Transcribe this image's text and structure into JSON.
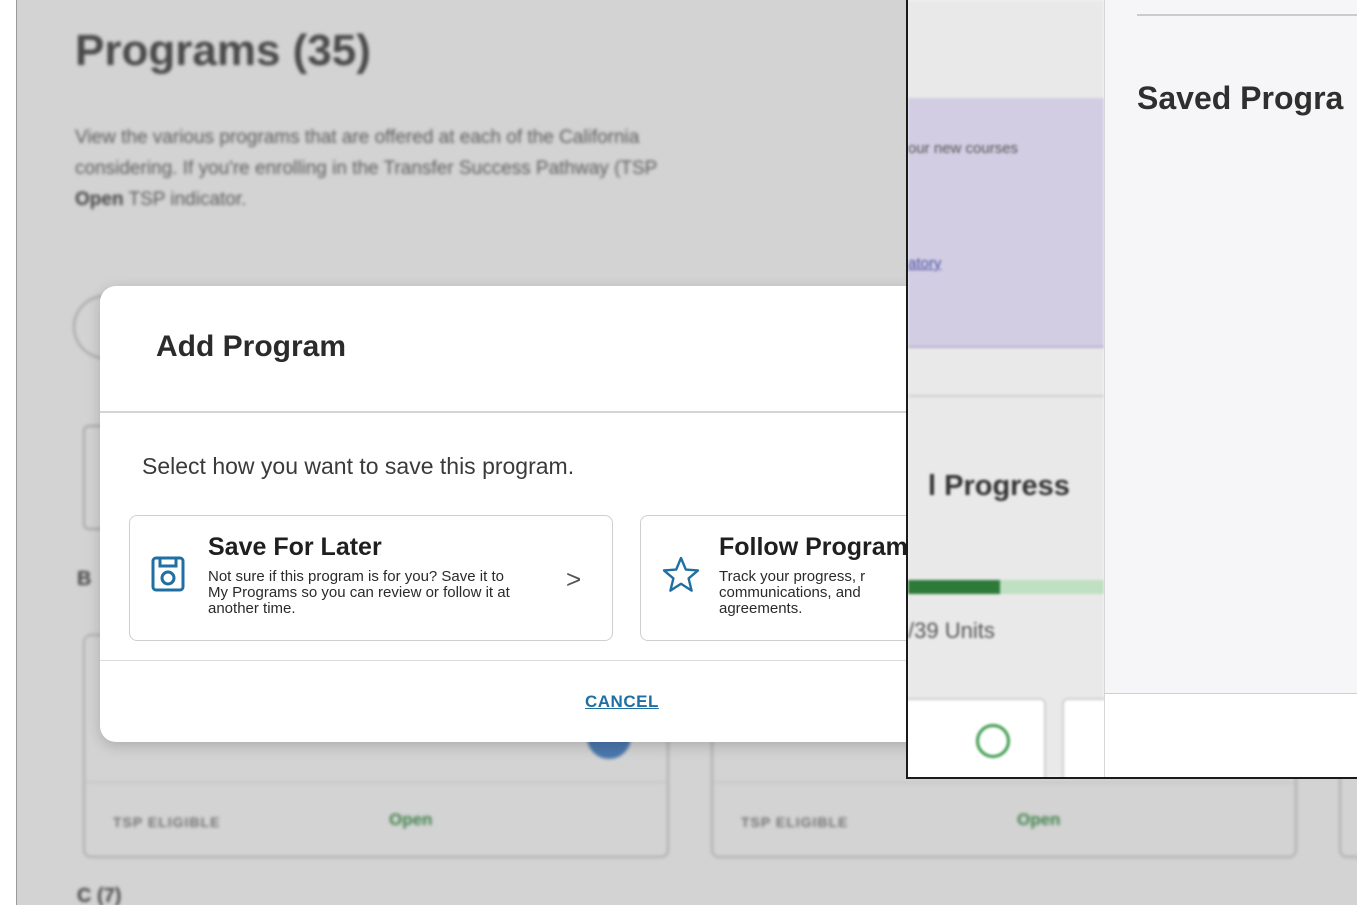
{
  "background_page": {
    "title": "Programs (35)",
    "description_line1": "View the various programs that are offered at each of the California",
    "description_line2": "considering. If you're enrolling in the Transfer Success Pathway (TSP",
    "description_bold": "Open",
    "description_line3_rest": " TSP indicator.",
    "section_letter": "B",
    "section_letter_2": "C (7)",
    "cards": [
      {
        "tsp_label": "TSP ELIGIBLE",
        "status": "Open"
      },
      {
        "tsp_label": "TSP ELIGIBLE",
        "status": "Open"
      }
    ],
    "colors": {
      "open_status": "#2e8b3c",
      "dim_overlay": "rgba(110,110,110,0.30)"
    }
  },
  "modal": {
    "title": "Add Program",
    "prompt": "Select how you want to save this program.",
    "options": [
      {
        "icon": "floppy-disk-icon",
        "title": "Save For Later",
        "description": "Not sure if this program is for you? Save it to My Programs so you can review or follow it at another time.",
        "chevron": ">"
      },
      {
        "icon": "star-outline-icon",
        "title": "Follow Program",
        "description": "Track your progress, r communications, and agreements."
      }
    ],
    "cancel_label": "CANCEL",
    "colors": {
      "icon": "#1f6fa3",
      "cancel": "#1f6fa3"
    }
  },
  "overlay": {
    "left_panel": {
      "banner_text": "our new courses",
      "banner_link": "atory",
      "progress_heading": "l Progress",
      "progress_fraction": 0.47,
      "units_text": "/39 Units",
      "colors": {
        "banner": "#d2cde3",
        "progress_fill": "#2d7a39",
        "progress_track": "#bfe0c2"
      }
    },
    "right_panel": {
      "title": "Saved Progra"
    }
  }
}
